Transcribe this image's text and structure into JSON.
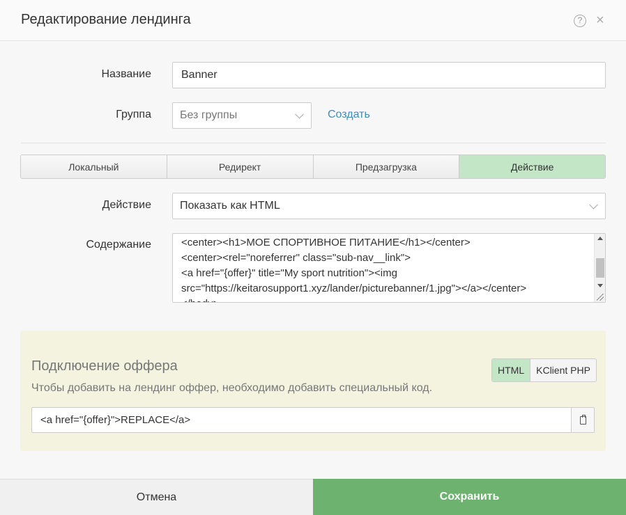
{
  "header": {
    "title": "Редактирование лендинга",
    "help_glyph": "?",
    "close_glyph": "×"
  },
  "form": {
    "name_label": "Название",
    "name_value": "Banner",
    "group_label": "Группа",
    "group_value": "Без группы",
    "create_link": "Создать"
  },
  "tabs": [
    {
      "label": "Локальный",
      "active": false
    },
    {
      "label": "Редирект",
      "active": false
    },
    {
      "label": "Предзагрузка",
      "active": false
    },
    {
      "label": "Действие",
      "active": true
    }
  ],
  "action": {
    "label": "Действие",
    "value": "Показать как HTML"
  },
  "content": {
    "label": "Содержание",
    "lines": [
      "<center><h1>МОЕ СПОРТИВНОЕ ПИТАНИЕ</h1></center>",
      "<center><rel=\"noreferrer\" class=\"sub-nav__link\">",
      "<a href=\"{offer}\" title=\"My sport nutrition\"><img",
      "src=\"https://keitarosupport1.xyz/lander/picturebanner/1.jpg\"></a></center>",
      "</body>"
    ]
  },
  "offer": {
    "title": "Подключение оффера",
    "hint": "Чтобы добавить на лендинг оффер, необходимо добавить специальный код.",
    "format_html": "HTML",
    "format_kclient": "KClient PHP",
    "code": "<a href=\"{offer}\">REPLACE</a>"
  },
  "footer": {
    "cancel_label": "Отмена",
    "save_label": "Сохранить"
  },
  "colors": {
    "accent_green": "#6db26f",
    "active_tab": "#c3e7c6",
    "link": "#3c8dbc",
    "offer_panel_bg": "#f3f3e0"
  },
  "icons": {
    "help": "question-circle-icon",
    "close": "close-icon",
    "copy": "clipboard-icon",
    "dropdown": "chevron-down-icon"
  }
}
